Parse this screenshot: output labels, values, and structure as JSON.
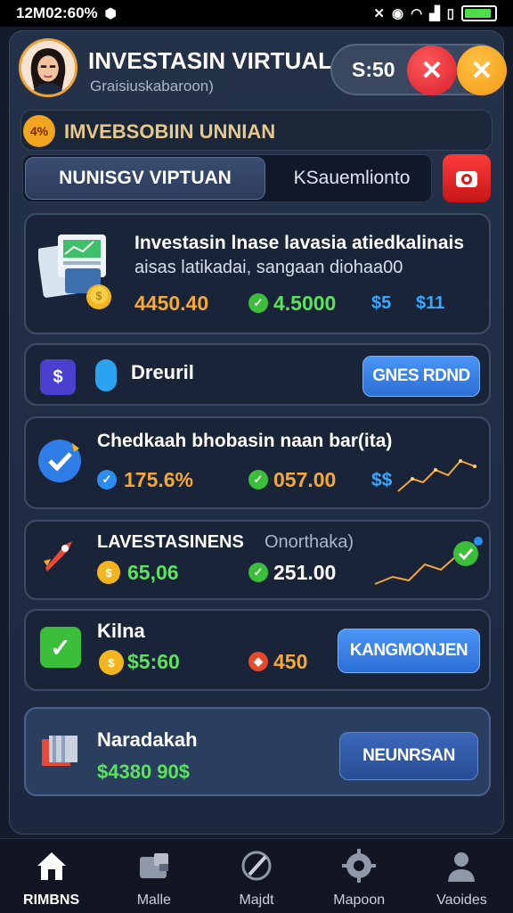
{
  "status_bar": {
    "time": "12M02:60%",
    "battery_level": 0.9
  },
  "header": {
    "title": "INVESTASIN VIRTUAL",
    "subtitle": "Graisiuskabaroon)",
    "balance": "S:50"
  },
  "banner": {
    "badge": "4%",
    "text": "IMVEBSOBIIN UNNIAN"
  },
  "tabs": {
    "active": "NUNISGV VIPTUAN",
    "inactive": "KSauemlionto"
  },
  "cards": [
    {
      "title": "Investasin lnase lavasia atiedkalinais",
      "subtitle": "aisas latikadai, sangaan diohaa00",
      "value1": "4450.40",
      "value2": "4.5000",
      "value3": "$5",
      "value4": "$11"
    },
    {
      "title": "Dreuril",
      "button": "GNES RDND"
    },
    {
      "title": "Chedkaah bhobasin naan bar(ita)",
      "value1": "175.6%",
      "value2": "057.00",
      "value3": "$$"
    },
    {
      "title": "LAVESTASINENS",
      "title_extra": "Onorthaka)",
      "value1": "65,06",
      "value2": "251.00"
    },
    {
      "title": "Kilna",
      "value1": "$5:60",
      "value2": "450",
      "button": "KANGMONJEN"
    },
    {
      "title": "Naradakah",
      "value1": "$4380 90$",
      "button": "NEUNRSAN"
    }
  ],
  "nav": [
    {
      "label": "RIMBNS",
      "icon": "home-icon"
    },
    {
      "label": "Malle",
      "icon": "wallet-icon"
    },
    {
      "label": "Majdt",
      "icon": "edit-icon"
    },
    {
      "label": "Mapoon",
      "icon": "gear-icon"
    },
    {
      "label": "Vaoides",
      "icon": "user-icon"
    }
  ],
  "colors": {
    "accent_green": "#5be45b",
    "accent_orange": "#f5a838",
    "accent_blue": "#3aa8ff",
    "accent_red": "#f55a3a"
  }
}
